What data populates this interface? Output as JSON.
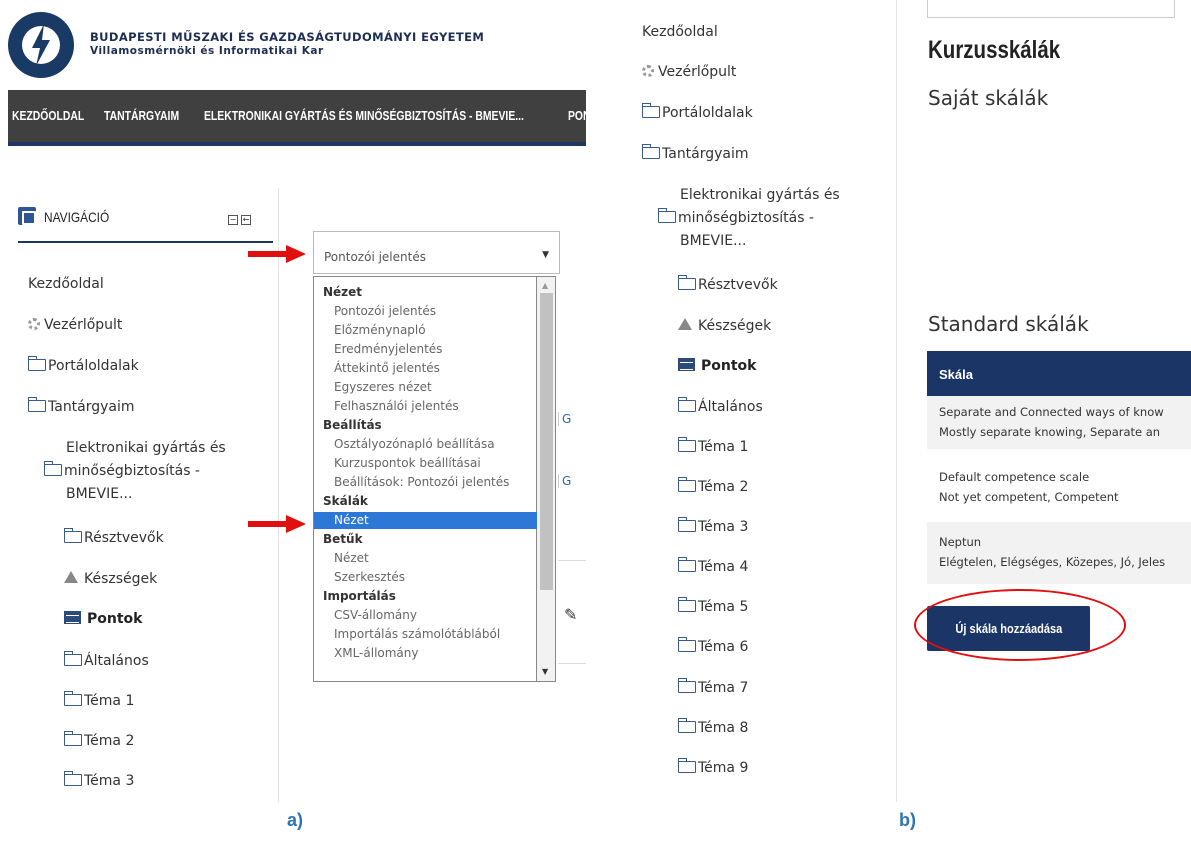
{
  "panel_a": {
    "university": {
      "name": "BUDAPESTI MŰSZAKI ÉS GAZDASÁGTUDOMÁNYI EGYETEM",
      "faculty": "Villamosmérnöki és Informatikai Kar"
    },
    "menu": [
      "KEZDŐOLDAL",
      "TANTÁRGYAIM",
      "ELEKTRONIKAI GYÁRTÁS ÉS MINŐSÉGBIZTOSÍTÁS - BMEVIE...",
      "PON"
    ],
    "navigation": {
      "title": "NAVIGÁCIÓ",
      "collapse": "−",
      "dock": "←",
      "items": {
        "home": "Kezdőoldal",
        "dashboard": "Vezérlőpult",
        "portals": "Portáloldalak",
        "courses": "Tantárgyaim",
        "course_line1": "Elektronikai gyártás és",
        "course_line2": "minőségbiztosítás -",
        "course_line3": "BMEVIE...",
        "participants": "Résztvevők",
        "skills": "Készségek",
        "grades": "Pontok",
        "general": "Általános",
        "topic1": "Téma 1",
        "topic2": "Téma 2",
        "topic3": "Téma 3"
      }
    },
    "select": {
      "value": "Pontozói jelentés",
      "arrow": "▼",
      "groups": {
        "view": "Nézet",
        "settings": "Beállítás",
        "scales": "Skálák",
        "letters": "Betűk",
        "import": "Importálás"
      },
      "options": {
        "grader_report": "Pontozói jelentés",
        "history": "Előzménynapló",
        "outcomes": "Eredményjelentés",
        "overview": "Áttekintő jelentés",
        "single_view": "Egyszeres nézet",
        "user_report": "Felhasználói jelentés",
        "gradebook_setup": "Osztályozónapló beállítása",
        "course_grade_settings": "Kurzuspontok beállításai",
        "preferences": "Beállítások: Pontozói jelentés",
        "scales_view": "Nézet",
        "letters_view": "Nézet",
        "letters_edit": "Szerkesztés",
        "csv": "CSV-állomány",
        "spreadsheet": "Importálás számolótáblából",
        "xml": "XML-állomány"
      },
      "scroll_up": "▲",
      "scroll_down": "▼"
    },
    "fragments": {
      "g1": "G",
      "g2": "G",
      "pencil": "✎"
    },
    "caption": "a)"
  },
  "panel_b": {
    "navigation": {
      "home": "Kezdőoldal",
      "dashboard": "Vezérlőpult",
      "portals": "Portáloldalak",
      "courses": "Tantárgyaim",
      "course_line1": "Elektronikai gyártás és",
      "course_line2": "minőségbiztosítás -",
      "course_line3": "BMEVIE...",
      "participants": "Résztvevők",
      "skills": "Készségek",
      "grades": "Pontok",
      "general": "Általános",
      "topic1": "Téma 1",
      "topic2": "Téma 2",
      "topic3": "Téma 3",
      "topic4": "Téma 4",
      "topic5": "Téma 5",
      "topic6": "Téma 6",
      "topic7": "Téma 7",
      "topic8": "Téma 8",
      "topic9": "Téma 9"
    },
    "title": "Kurzusskálák",
    "own_scales": "Saját skálák",
    "standard_scales": "Standard skálák",
    "table": {
      "header": "Skála",
      "rows": [
        {
          "name": "Separate and Connected ways of know",
          "values": "Mostly separate knowing, Separate an"
        },
        {
          "name": "Default competence scale",
          "values": "Not yet competent, Competent"
        },
        {
          "name": "Neptun",
          "values": "Elégtelen, Elégséges, Közepes, Jó, Jeles"
        }
      ]
    },
    "add_button": "Új skála hozzáadása",
    "caption": "b)"
  },
  "colors": {
    "navy": "#1b3566",
    "menubar": "#404040",
    "selection": "#2d78d6",
    "annotation_red": "#e01010",
    "caption_blue": "#2e74b5"
  }
}
